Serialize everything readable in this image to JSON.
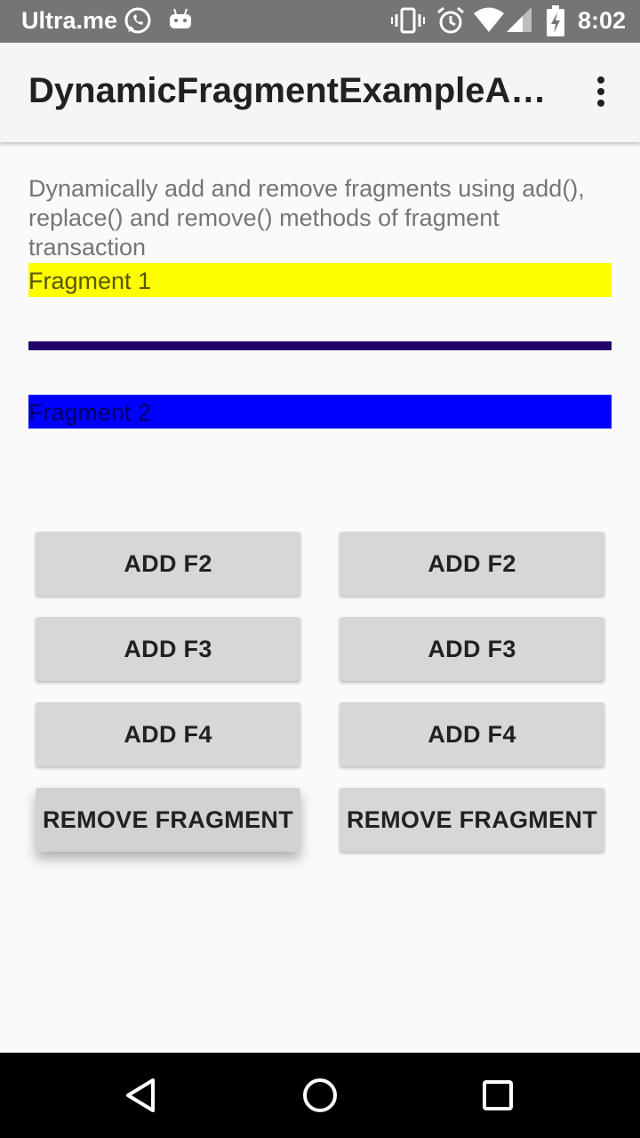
{
  "status_bar": {
    "carrier": "Ultra.me",
    "time": "8:02",
    "icons": [
      "whatsapp-icon",
      "android-icon",
      "vibrate-icon",
      "alarm-icon",
      "wifi-icon",
      "signal-icon",
      "battery-charging-icon"
    ]
  },
  "app_bar": {
    "title": "DynamicFragmentExampleActi...",
    "menu_icon": "more-vert-icon"
  },
  "content": {
    "description": "Dynamically add and remove fragments using add(), replace() and remove() methods of fragment transaction",
    "fragment1_label": "Fragment 1",
    "fragment2_label": "Fragment 2",
    "colors": {
      "fragment1_bg": "#ffff00",
      "divider": "#24006b",
      "fragment2_bg": "#0000ff"
    }
  },
  "buttons": {
    "left": [
      "ADD F2",
      "ADD F3",
      "ADD F4",
      "REMOVE FRAGMENT"
    ],
    "right": [
      "ADD F2",
      "ADD F3",
      "ADD F4",
      "REMOVE FRAGMENT"
    ]
  },
  "nav_bar": {
    "icons": [
      "back-icon",
      "home-icon",
      "recents-icon"
    ]
  }
}
